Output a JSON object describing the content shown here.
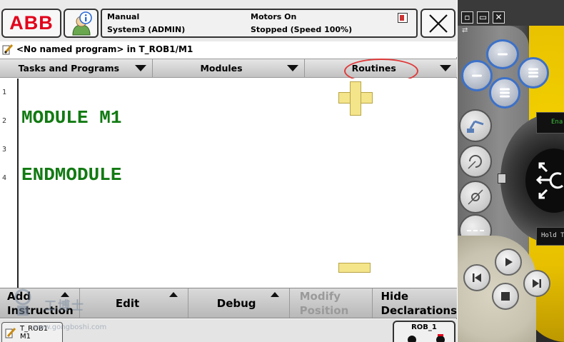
{
  "header": {
    "logo_text": "ABB",
    "mode": "Manual",
    "system": "System3 (ADMIN)",
    "motors": "Motors On",
    "state": "Stopped (Speed 100%)"
  },
  "program": {
    "title": "<No named program> in T_ROB1/M1"
  },
  "menus": [
    {
      "label": "Tasks and Programs"
    },
    {
      "label": "Modules"
    },
    {
      "label": "Routines"
    }
  ],
  "code": {
    "line_numbers": [
      "1",
      "2",
      "3",
      "4"
    ],
    "lines": [
      "",
      "MODULE M1",
      "",
      "ENDMODULE"
    ]
  },
  "bottom_menu": {
    "add_instruction": "Add\nInstruction",
    "edit": "Edit",
    "debug": "Debug",
    "modify_position": "Modify\nPosition",
    "hide_declarations": "Hide\nDeclarations"
  },
  "taskbar": {
    "task_line1": "T_ROB1",
    "task_line2": "M1",
    "rob_label": "ROB_1"
  },
  "watermark": {
    "text": "工博士",
    "url": "www.gongboshi.com"
  },
  "hardware": {
    "enable_label": "Ena",
    "hold_label": "Hold T"
  },
  "colors": {
    "abb_red": "#e2001a",
    "code_green": "#127a12",
    "zoom_yellow": "#f4e48a",
    "highlight_ring": "#e03a3a",
    "key_blue": "#3c71c9",
    "pendant_yellow": "#e8c000"
  },
  "icons": {
    "info": "info-user-icon",
    "close": "close-x-icon",
    "program": "pencil-document-icon",
    "dropdown": "triangle-down-icon",
    "popup": "triangle-up-icon"
  }
}
